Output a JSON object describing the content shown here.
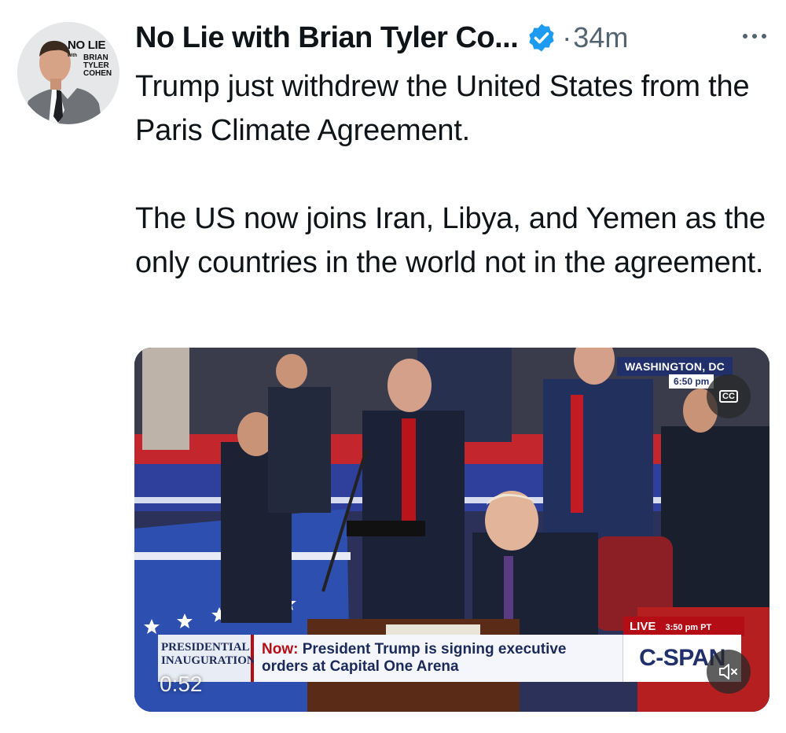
{
  "account": {
    "display_name": "No Lie with Brian Tyler Co...",
    "verified": true,
    "separator": "·",
    "timestamp": "34m",
    "avatar_brand_big": "NO LIE",
    "avatar_brand_small_1": "with",
    "avatar_brand_small_2": "BRIAN",
    "avatar_brand_small_3": "TYLER",
    "avatar_brand_small_4": "COHEN"
  },
  "post": {
    "paragraph_1": "Trump just withdrew the United States from the Paris Climate Agreement.",
    "paragraph_2": "The US now joins Iran, Libya, and Yemen as the only countries in the world not in the agreement."
  },
  "video": {
    "location": "WASHINGTON, DC",
    "location_time": "6:50 pm",
    "cc_label": "CC",
    "live_label": "LIVE",
    "live_time": "3:50 pm PT",
    "event_line_1": "PRESIDENTIAL",
    "event_line_2": "INAUGURATION",
    "caption_now": "Now:",
    "caption_text": "President Trump is signing executive orders at Capital One Arena",
    "network": "C-SPAN",
    "duration": "0:52"
  },
  "colors": {
    "verified_blue": "#1d9bf0",
    "secondary_text": "#536471",
    "cspan_red": "#b40d16",
    "cspan_navy": "#21306a"
  },
  "icons": [
    "verified-badge-icon",
    "more-options-icon",
    "closed-captions-icon",
    "mute-icon"
  ]
}
